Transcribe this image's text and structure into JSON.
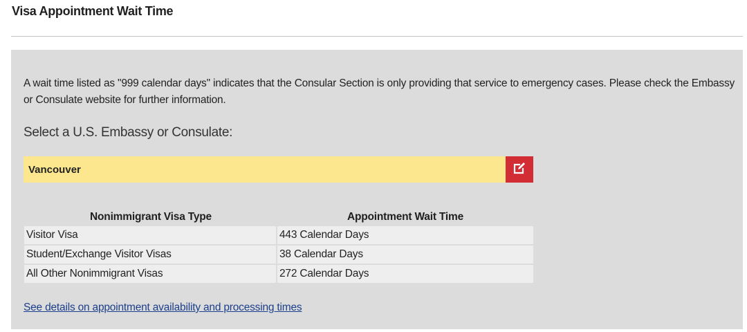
{
  "page": {
    "title": "Visa Appointment Wait Time"
  },
  "panel": {
    "notice": "A wait time listed as \"999 calendar days\" indicates that the Consular Section is only providing that service to emergency cases.  Please check the Embassy or Consulate website for further information.",
    "select_heading": "Select a U.S. Embassy or Consulate:",
    "selected_post": "Vancouver",
    "edit_icon": "edit-icon",
    "table": {
      "headers": [
        "Nonimmigrant Visa Type",
        "Appointment Wait Time"
      ],
      "rows": [
        {
          "type": "Visitor Visa",
          "wait": "443 Calendar Days"
        },
        {
          "type": "Student/Exchange Visitor Visas",
          "wait": "38 Calendar Days"
        },
        {
          "type": "All Other Nonimmigrant Visas",
          "wait": "272 Calendar Days"
        }
      ]
    },
    "details_link": "See details on appointment availability and processing times"
  },
  "colors": {
    "panel_bg": "#dcdcdc",
    "selected_bg": "#fce78e",
    "edit_button_bg": "#d22d35",
    "link": "#1b3f8a"
  }
}
